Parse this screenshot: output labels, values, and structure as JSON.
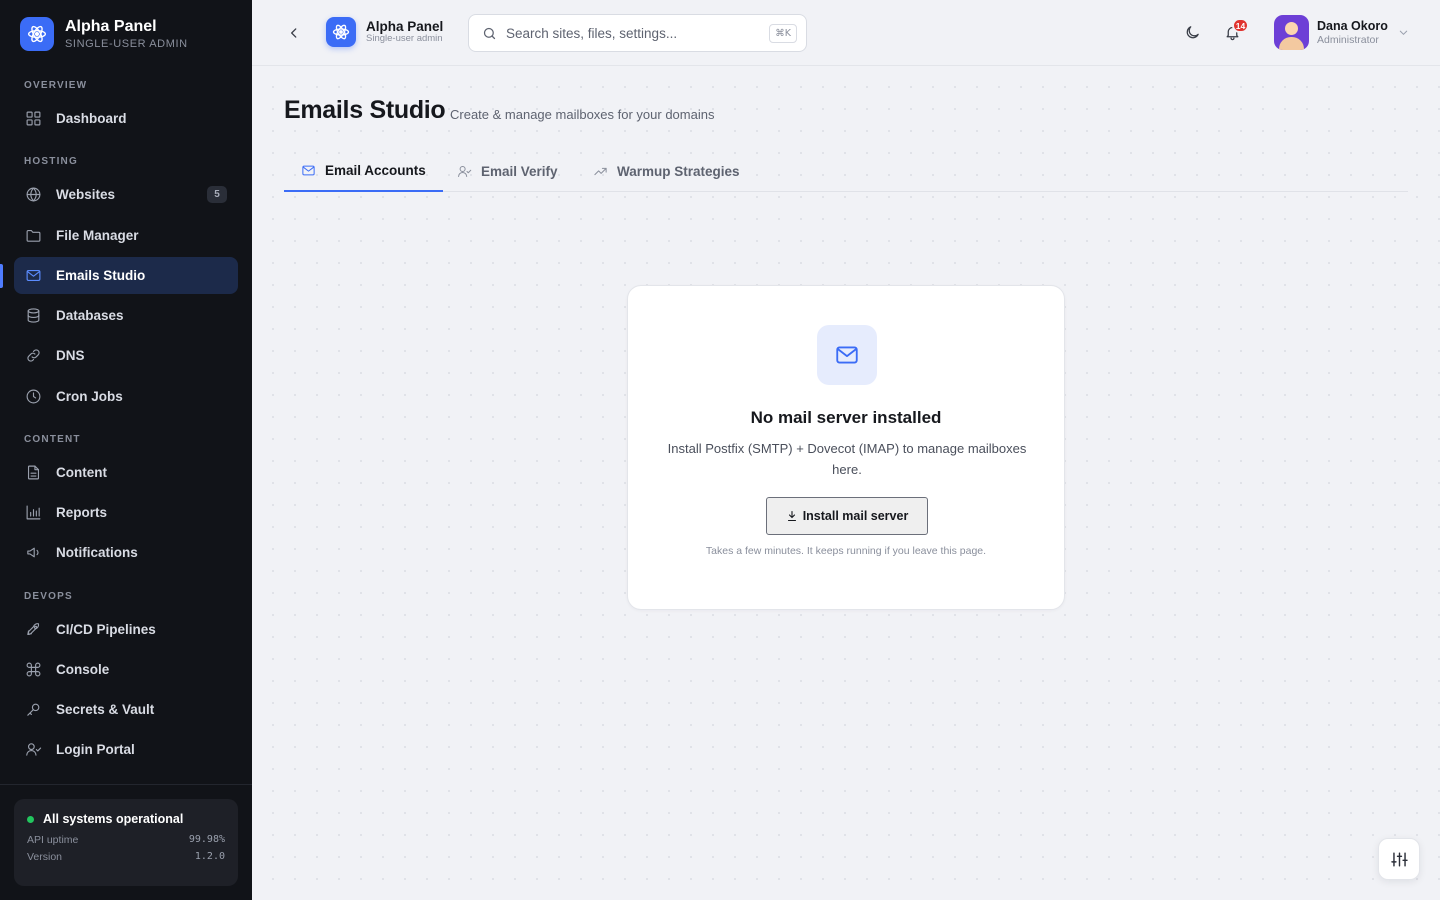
{
  "brand": {
    "name": "Alpha Panel",
    "subtitle": "SINGLE-USER ADMIN"
  },
  "sidebar": {
    "sections": {
      "overview": "OVERVIEW",
      "hosting": "HOSTING",
      "content": "CONTENT",
      "devops": "DEVOPS"
    },
    "items": {
      "dashboard": {
        "label": "Dashboard",
        "icon": "grid-icon"
      },
      "websites": {
        "label": "Websites",
        "icon": "globe-icon",
        "count": "5"
      },
      "file_manager": {
        "label": "File Manager",
        "icon": "folder-icon"
      },
      "emails_studio": {
        "label": "Emails Studio",
        "icon": "mail-icon",
        "active": true
      },
      "databases": {
        "label": "Databases",
        "icon": "database-icon"
      },
      "dns": {
        "label": "DNS",
        "icon": "link-icon"
      },
      "cron_jobs": {
        "label": "Cron Jobs",
        "icon": "clock-icon"
      },
      "content": {
        "label": "Content",
        "icon": "document-icon"
      },
      "reports": {
        "label": "Reports",
        "icon": "bar-chart-icon"
      },
      "notifications": {
        "label": "Notifications",
        "icon": "megaphone-icon"
      },
      "cicd": {
        "label": "CI/CD Pipelines",
        "icon": "rocket-icon"
      },
      "console": {
        "label": "Console",
        "icon": "command-icon"
      },
      "secrets": {
        "label": "Secrets & Vault",
        "icon": "key-icon"
      },
      "login_portal": {
        "label": "Login Portal",
        "icon": "user-check-icon"
      }
    },
    "status": {
      "title": "All systems operational",
      "uptime_label": "API uptime",
      "uptime_value": "99.98%",
      "version_label": "Version",
      "version_value": "1.2.0",
      "dot_color": "#22c55e"
    }
  },
  "topbar": {
    "brand_name": "Alpha Panel",
    "brand_sub": "Single-user admin",
    "search_placeholder": "Search sites, files, settings...",
    "search_shortcut": "⌘K",
    "notifications_count": "14",
    "user": {
      "name": "Dana Okoro",
      "role": "Administrator"
    }
  },
  "page": {
    "title": "Emails Studio",
    "subtitle": "Create & manage mailboxes for your domains",
    "tabs": {
      "accounts": "Email Accounts",
      "verify": "Email Verify",
      "warmup": "Warmup Strategies"
    },
    "empty_state": {
      "title": "No mail server installed",
      "description": "Install Postfix (SMTP) + Dovecot (IMAP) to manage mailboxes here.",
      "button": "Install mail server",
      "note": "Takes a few minutes. It keeps running if you leave this page."
    }
  },
  "colors": {
    "accent": "#3b6cf6",
    "sidebar_bg": "#111318",
    "notification_badge": "#e0332e"
  }
}
